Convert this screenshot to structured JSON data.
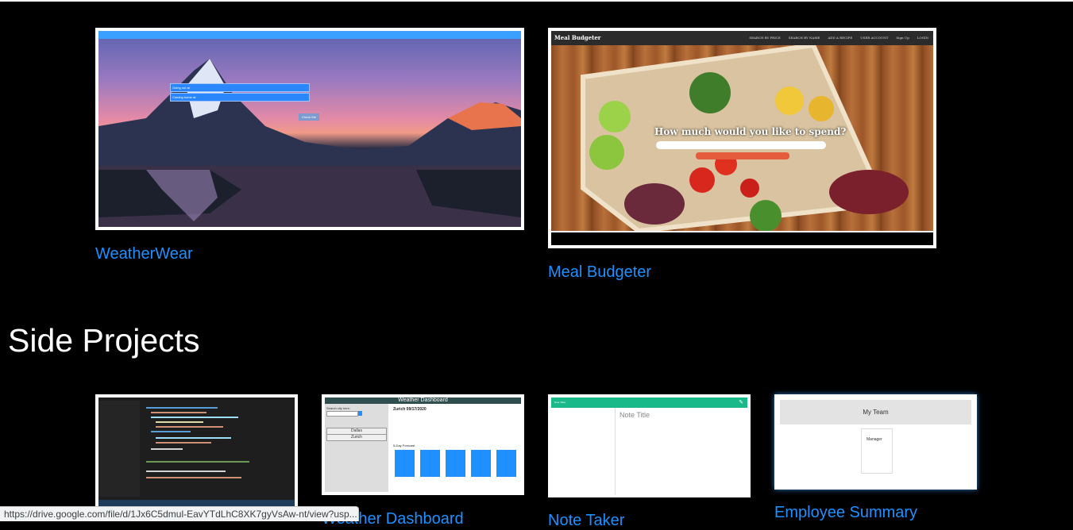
{
  "featured_projects": [
    {
      "title": "WeatherWear"
    },
    {
      "title": "Meal Budgeter"
    }
  ],
  "side_projects_heading": "Side Projects",
  "side_projects": [
    {
      "title": "Weather Dashboard"
    },
    {
      "title": "Note Taker"
    },
    {
      "title": "Employee Summary"
    }
  ],
  "thumbs": {
    "weatherwear": {
      "input1": "Going out at",
      "input2": "Coming home at",
      "button": "Check Me"
    },
    "meal_budgeter": {
      "brand": "Meal Budgeter",
      "nav": [
        "SEARCH BY PRICE",
        "SEARCH BY NAME",
        "ADD A RECIPE",
        "USER ACCOUNT",
        "Sign Up",
        "LOGIN"
      ],
      "question": "How much would you like to spend?"
    },
    "weather_dashboard": {
      "title": "Weather Dashboard",
      "search_label": "Search city here:",
      "city_title": "Zurich 09/17/2020",
      "cities": [
        "Dallas",
        "Zurich"
      ],
      "forecast_label": "5-Day Forecast"
    },
    "note_taker": {
      "bar": "Note Taker",
      "note_title": "Note Title"
    },
    "employee_summary": {
      "header": "My Team",
      "role": "Manager"
    }
  },
  "status_url": "https://drive.google.com/file/d/1Jx6C5dmul-EavYTdLhC8XK7gyVsAw-nt/view?usp..."
}
